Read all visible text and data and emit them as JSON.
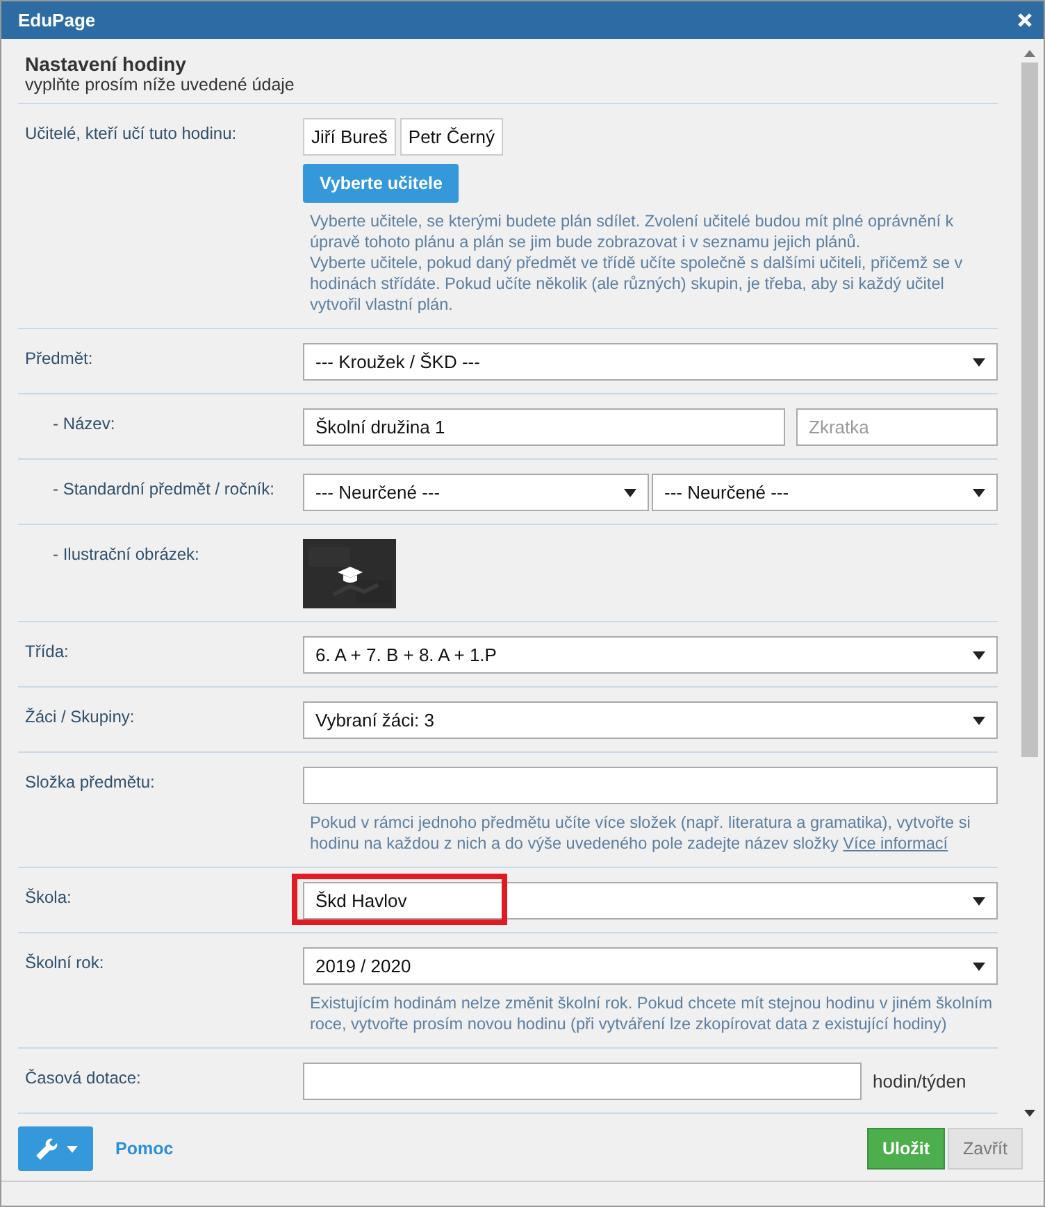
{
  "window": {
    "title": "EduPage"
  },
  "header": {
    "title": "Nastavení hodiny",
    "subtitle": "vyplňte prosím níže uvedené údaje"
  },
  "rows": [
    {
      "kind": "teachers",
      "label": "Učitelé, kteří učí tuto hodinu:",
      "chips": [
        "Jiří Bureš",
        "Petr Černý"
      ],
      "button": "Vyberte učitele",
      "help": [
        "Vyberte učitele, se kterými budete plán sdílet. Zvolení učitelé budou mít plné oprávnění k úpravě tohoto plánu a plán se jim bude zobrazovat i v seznamu jejich plánů.",
        "Vyberte učitele, pokud daný předmět ve třídě učíte společně s dalšími učiteli, přičemž se v hodinách střídáte. Pokud učíte několik (ale různých) skupin, je třeba, aby si každý učitel vytvořil vlastní plán."
      ]
    },
    {
      "kind": "select",
      "label": "Předmět:",
      "value": "--- Kroužek / ŠKD ---",
      "children": [
        {
          "kind": "name",
          "label": "- Název:",
          "value": "Školní družina 1",
          "placeholder": "Zkratka"
        },
        {
          "kind": "double_select",
          "label": "- Standardní předmět / ročník:",
          "values": [
            "--- Neurčené ---",
            "--- Neurčené ---"
          ]
        },
        {
          "label": "- Ilustrační obrázek:"
        }
      ]
    },
    {
      "kind": "select",
      "label": "Třída:",
      "value": "6. A + 7. B + 8. A + 1.P"
    },
    {
      "kind": "select",
      "label": "Žáci / Skupiny:",
      "value": "Vybraní žáci: 3"
    },
    {
      "kind": "text",
      "label": "Složka předmětu:",
      "help": "Pokud v rámci jednoho předmětu učíte více složek (např. literatura a gramatika), vytvořte si hodinu na každou z nich a do výše uvedeného pole zadejte název složky",
      "link": "Více informací"
    },
    {
      "kind": "select",
      "label": "Škola:",
      "value": "Škd Havlov",
      "highlighted": true
    },
    {
      "kind": "select",
      "label": "Školní rok:",
      "value": "2019 / 2020",
      "help": "Existujícím hodinám nelze změnit školní rok. Pokud chcete mít stejnou hodinu v jiném školním roce, vytvořte prosím novou hodinu (při vytváření lze zkopírovat data z existující hodiny)"
    },
    {
      "kind": "text",
      "label": "Časová dotace:",
      "suffix": "hodin/týden"
    }
  ],
  "footer": {
    "help_link": "Pomoc",
    "save": "Uložit",
    "close": "Zavřít"
  }
}
